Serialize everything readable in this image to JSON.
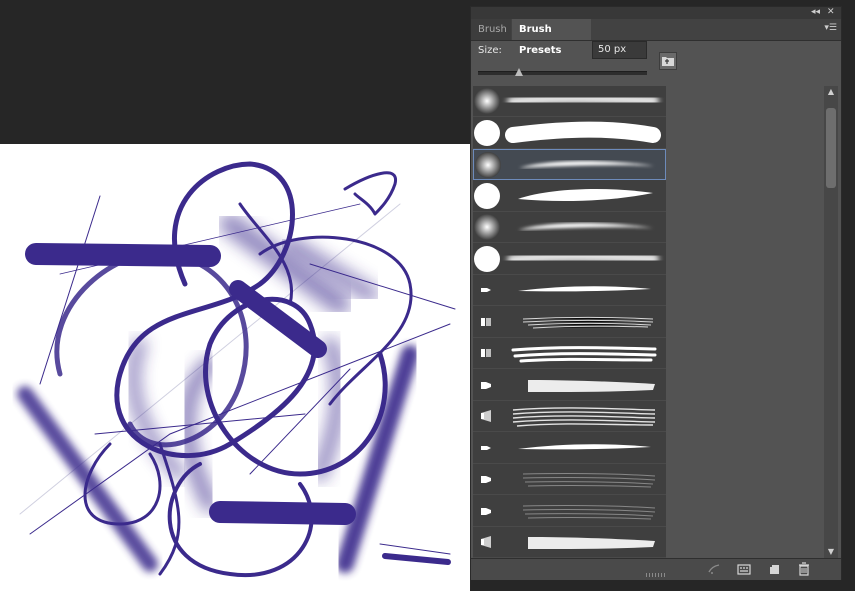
{
  "panel": {
    "collapse_icon": "double-chevron-left-icon",
    "close_icon": "close-icon",
    "tabs": [
      {
        "label": "Brush",
        "active": false
      },
      {
        "label": "Brush Presets",
        "active": true
      }
    ],
    "menu_icon": "panel-menu-icon",
    "size_label": "Size:",
    "size_value": "50 px",
    "size_slider_fraction": 0.24
  },
  "presets": [
    {
      "tip": "soft-round",
      "stroke": "soft-wide"
    },
    {
      "tip": "hard-round",
      "stroke": "hard-wide"
    },
    {
      "tip": "soft-round",
      "stroke": "soft-taper",
      "selected": true
    },
    {
      "tip": "hard-round",
      "stroke": "hard-taper"
    },
    {
      "tip": "soft-round",
      "stroke": "soft-taper"
    },
    {
      "tip": "hard-round",
      "stroke": "soft-wide"
    },
    {
      "tip": "pen-tip",
      "stroke": "thin-taper"
    },
    {
      "tip": "bristle-tip",
      "stroke": "bristle"
    },
    {
      "tip": "bristle-tip",
      "stroke": "bristle-multi"
    },
    {
      "tip": "flat-tip",
      "stroke": "dry"
    },
    {
      "tip": "fan-tip",
      "stroke": "bristle-wide"
    },
    {
      "tip": "pen-tip",
      "stroke": "thin-taper"
    },
    {
      "tip": "flat-tip",
      "stroke": "dry-dark"
    },
    {
      "tip": "flat-tip",
      "stroke": "dry-dark"
    },
    {
      "tip": "fan-tip",
      "stroke": "dry"
    }
  ],
  "footer": {
    "icons": [
      "toggle-brush-panel-icon",
      "open-preset-manager-icon",
      "new-brush-icon",
      "delete-brush-icon"
    ]
  },
  "colors": {
    "ink": "#3b2a8c",
    "workspace": "#262626",
    "panel": "#535353",
    "selection": "#6d8bbb"
  }
}
